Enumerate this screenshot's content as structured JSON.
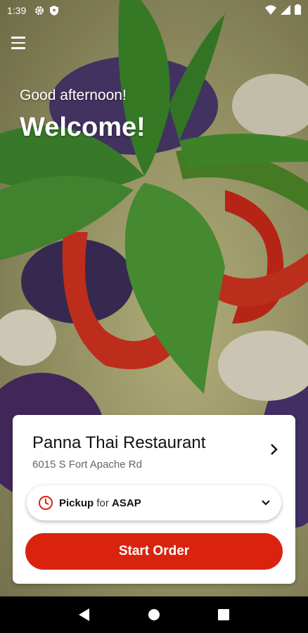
{
  "status_bar": {
    "time": "1:39"
  },
  "hero": {
    "greeting": "Good afternoon!",
    "title": "Welcome!"
  },
  "restaurant": {
    "name": "Panna Thai Restaurant",
    "address": "6015 S Fort Apache Rd"
  },
  "order_mode": {
    "mode": "Pickup",
    "connector": "for",
    "time": "ASAP"
  },
  "actions": {
    "start_order": "Start Order"
  },
  "colors": {
    "accent": "#d9230f",
    "card_bg": "#ffffff"
  }
}
